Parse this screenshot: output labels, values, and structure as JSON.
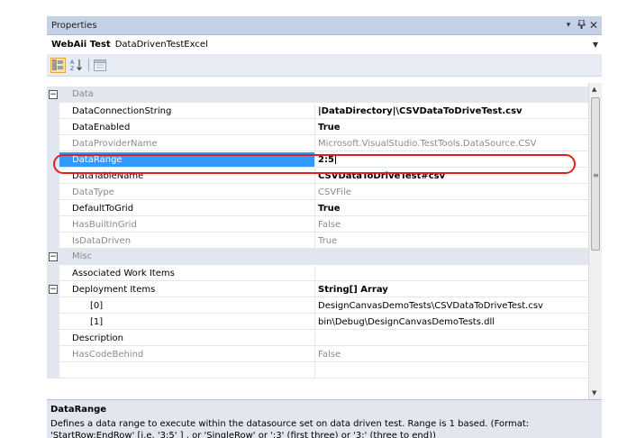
{
  "titlebar": {
    "title": "Properties",
    "dropdown_glyph": "▾",
    "pin_glyph": "ᵃ",
    "close_glyph": "✕"
  },
  "object_selector": {
    "name": "WebAii Test",
    "type": "DataDrivenTestExcel"
  },
  "toolbar": {
    "icons": [
      "categorized-icon",
      "alphabetical-icon",
      "property-pages-icon"
    ]
  },
  "categories": {
    "data": "Data",
    "misc": "Misc"
  },
  "rows": [
    {
      "name": "DataConnectionString",
      "value": "|DataDirectory|\\CSVDataToDriveTest.csv"
    },
    {
      "name": "DataEnabled",
      "value": "True"
    },
    {
      "name": "DataProviderName",
      "value": "Microsoft.VisualStudio.TestTools.DataSource.CSV"
    },
    {
      "name": "DataRange",
      "value": "2:5"
    },
    {
      "name": "DataTableName",
      "value": "CSVDataToDriveTest#csv"
    },
    {
      "name": "DataType",
      "value": "CSVFile"
    },
    {
      "name": "DefaultToGrid",
      "value": "True"
    },
    {
      "name": "HasBuiltInGrid",
      "value": "False"
    },
    {
      "name": "IsDataDriven",
      "value": "True"
    },
    {
      "name": "Associated Work Items",
      "value": ""
    },
    {
      "name": "Deployment Items",
      "value": "String[] Array"
    },
    {
      "name": "[0]",
      "value": "DesignCanvasDemoTests\\CSVDataToDriveTest.csv"
    },
    {
      "name": "[1]",
      "value": "bin\\Debug\\DesignCanvasDemoTests.dll"
    },
    {
      "name": "Description",
      "value": ""
    },
    {
      "name": "HasCodeBehind",
      "value": "False"
    }
  ],
  "description": {
    "title": "DataRange",
    "text": "Defines a data range to execute within the datasource set on data driven test. Range is 1 based. (Format: 'StartRow:EndRow' [i.e. '3:5' ] , or 'SingleRow' or ':3' (first three) or '3:' (three to end))"
  },
  "colors": {
    "selection": "#3399ff",
    "highlight_ring": "#e0201f",
    "category_band": "#e1e6ef",
    "title_bar": "#c5d1e6"
  }
}
